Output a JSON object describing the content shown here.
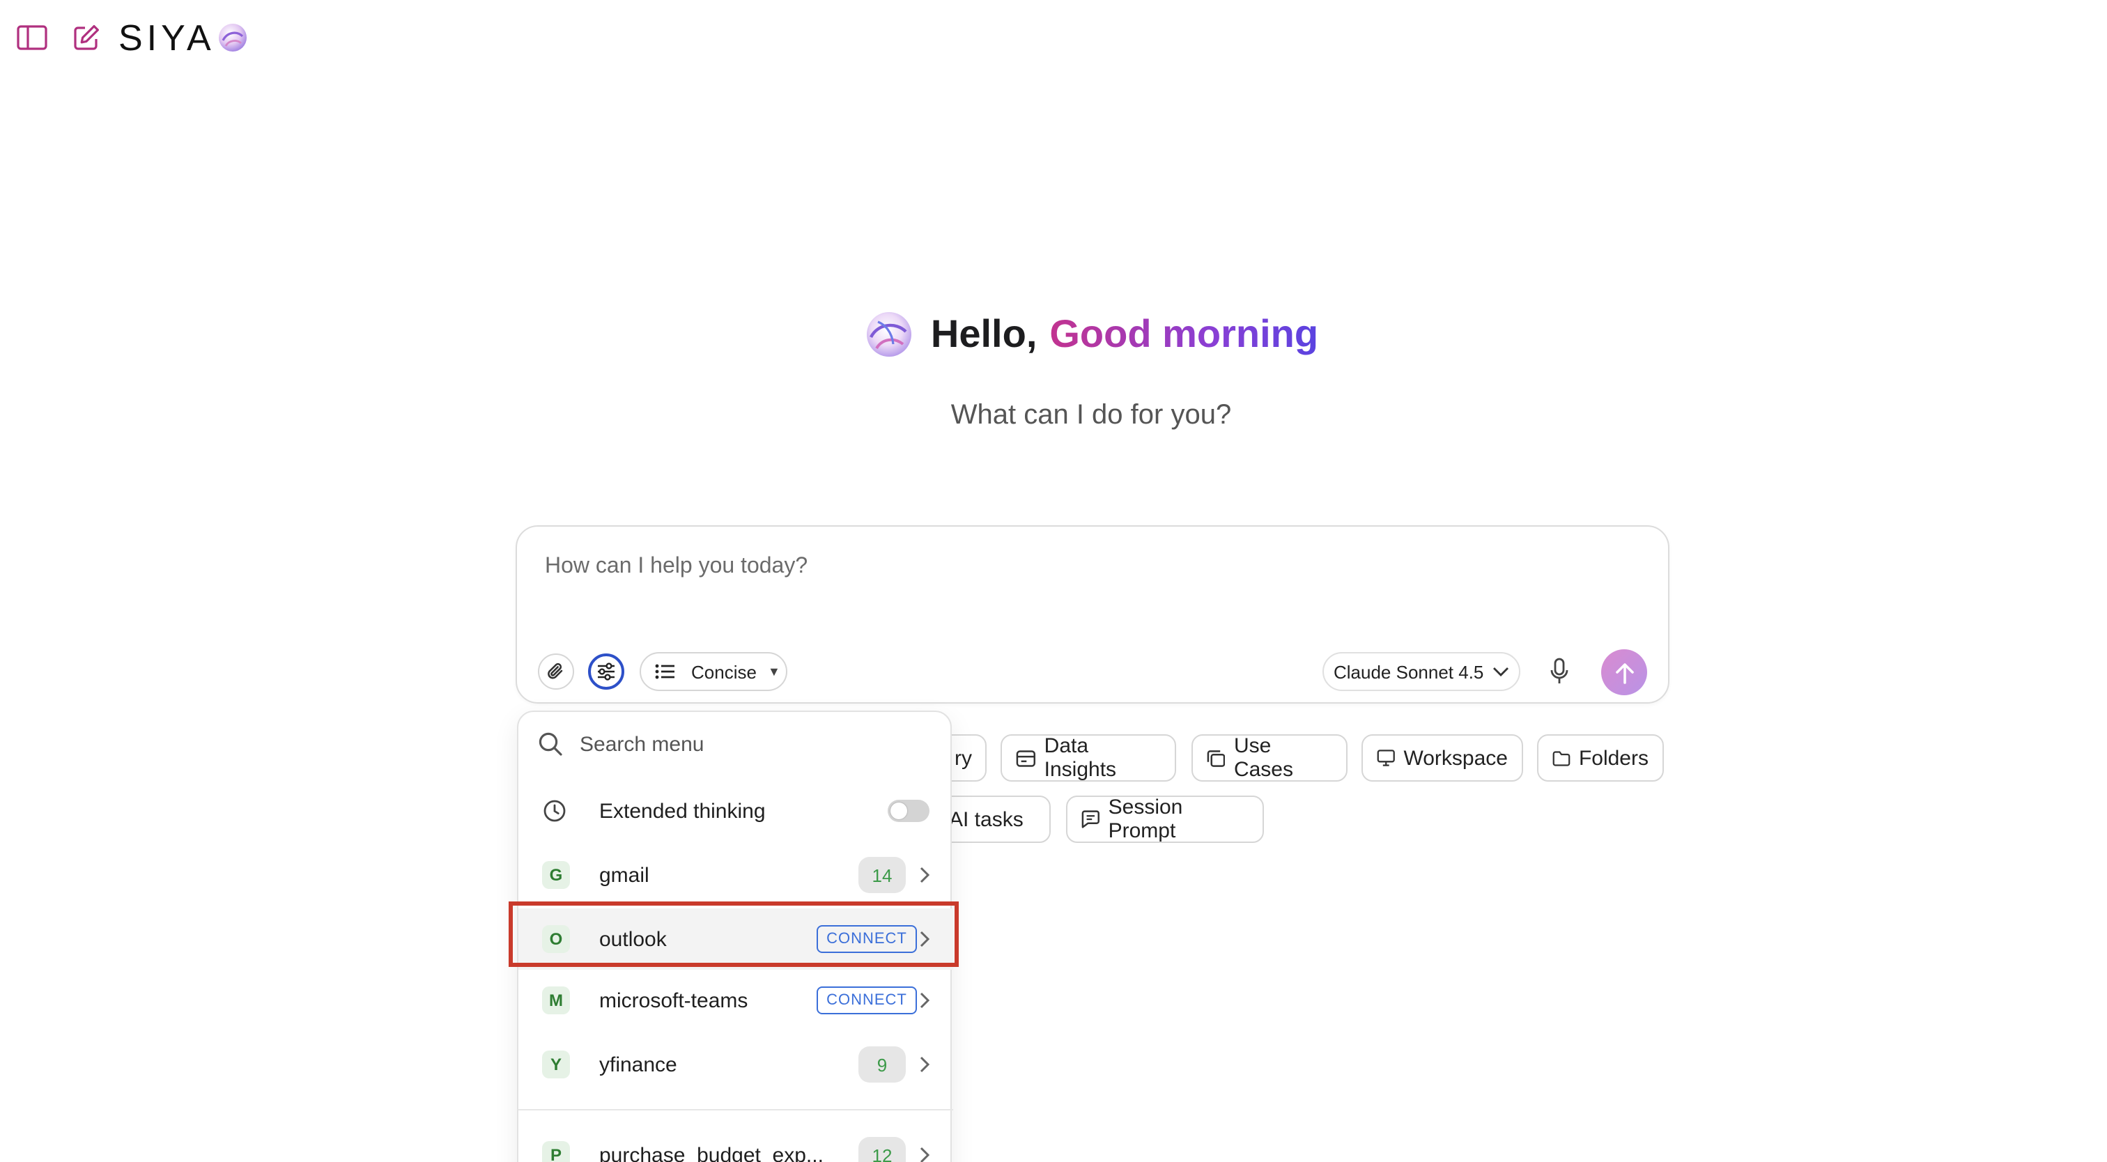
{
  "brand": {
    "name": "SIYA"
  },
  "greeting": {
    "hello": "Hello,",
    "accent": "Good morning",
    "subtitle": "What can I do for you?"
  },
  "composer": {
    "placeholder": "How can I help you today?",
    "style_label": "Concise",
    "model_label": "Claude Sonnet 4.5"
  },
  "chips": {
    "partial_top": "ry",
    "data_insights": "Data Insights",
    "use_cases": "Use Cases",
    "workspace": "Workspace",
    "folders": "Folders",
    "ai_tasks": "AI tasks",
    "session_prompt": "Session Prompt"
  },
  "menu": {
    "search_placeholder": "Search menu",
    "extended_thinking": "Extended thinking",
    "items": [
      {
        "letter": "G",
        "label": "gmail",
        "count": "14"
      },
      {
        "letter": "O",
        "label": "outlook",
        "action": "CONNECT"
      },
      {
        "letter": "M",
        "label": "microsoft-teams",
        "action": "CONNECT"
      },
      {
        "letter": "Y",
        "label": "yfinance",
        "count": "9"
      },
      {
        "letter": "P",
        "label": "purchase_budget_exp...",
        "count": "12"
      }
    ]
  },
  "colors": {
    "accent_gradient_start": "#c2338f",
    "accent_gradient_end": "#5a43e0",
    "settings_ring": "#2d50c8",
    "connect_blue": "#3b6fd9",
    "highlight_red": "#c93a2b",
    "count_green": "#3c9a49"
  }
}
